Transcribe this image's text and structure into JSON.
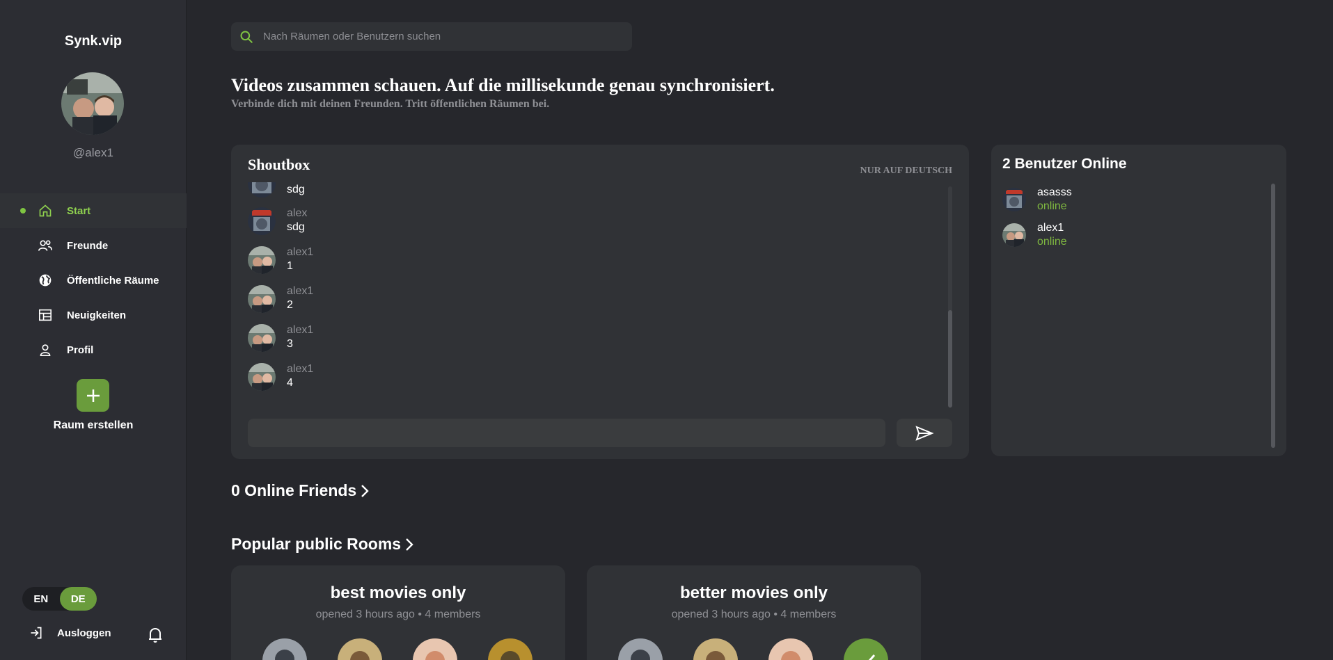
{
  "sidebar": {
    "brand": "Synk.vip",
    "username": "@alex1",
    "nav": [
      {
        "label": "Start",
        "icon": "home-icon"
      },
      {
        "label": "Freunde",
        "icon": "friends-icon"
      },
      {
        "label": "Öffentliche Räume",
        "icon": "globe-icon"
      },
      {
        "label": "Neuigkeiten",
        "icon": "news-icon"
      },
      {
        "label": "Profil",
        "icon": "profile-icon"
      }
    ],
    "create_room": "Raum erstellen",
    "lang": {
      "en": "EN",
      "de": "DE"
    },
    "logout": "Ausloggen"
  },
  "search": {
    "placeholder": "Nach Räumen oder Benutzern suchen"
  },
  "hero": {
    "title": "Videos zusammen schauen. Auf die millisekunde genau synchronisiert.",
    "subtitle": "Verbinde dich mit deinen Freunden. Tritt öffentlichen Räumen bei."
  },
  "shoutbox": {
    "title": "Shoutbox",
    "tag": "NUR AUF DEUTSCH",
    "messages": [
      {
        "user": "",
        "text": "sdg"
      },
      {
        "user": "alex",
        "text": "sdg"
      },
      {
        "user": "alex1",
        "text": "1"
      },
      {
        "user": "alex1",
        "text": "2"
      },
      {
        "user": "alex1",
        "text": "3"
      },
      {
        "user": "alex1",
        "text": "4"
      }
    ],
    "input_value": ""
  },
  "online_users": {
    "title": "2 Benutzer Online",
    "users": [
      {
        "name": "asasss",
        "status": "online"
      },
      {
        "name": "alex1",
        "status": "online"
      }
    ]
  },
  "friends": {
    "title": "0 Online Friends"
  },
  "rooms": {
    "title": "Popular public Rooms",
    "items": [
      {
        "title": "best movies only",
        "meta": "opened 3 hours ago • 4 members"
      },
      {
        "title": "better movies only",
        "meta": "opened 3 hours ago • 4 members"
      }
    ]
  },
  "colors": {
    "accent": "#8fd14f",
    "button": "#6a9c3c",
    "bg": "#26272c",
    "panel": "#303236"
  }
}
